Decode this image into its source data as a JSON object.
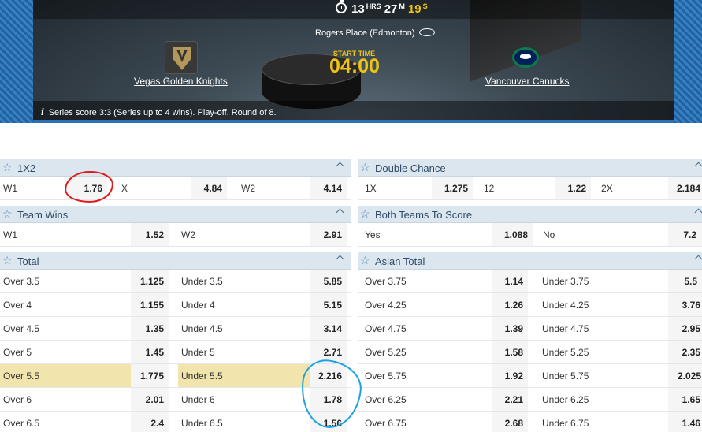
{
  "countdown": {
    "hours": "13",
    "hours_unit": "HRS",
    "minutes": "27",
    "minutes_unit": "M",
    "seconds": "19",
    "seconds_unit": "S"
  },
  "venue": "Rogers Place (Edmonton)",
  "start_time_label": "START TIME",
  "start_time": "04:00",
  "home_team": "Vegas Golden Knights",
  "away_team": "Vancouver Canucks",
  "series_info": "Series score 3:3 (Series up to 4 wins). Play-off. Round of 8.",
  "markets": {
    "m1x2": {
      "title": "1X2",
      "row": [
        {
          "label": "W1",
          "odd": "1.76"
        },
        {
          "label": "X",
          "odd": "4.84"
        },
        {
          "label": "W2",
          "odd": "4.14"
        }
      ]
    },
    "double_chance": {
      "title": "Double Chance",
      "row": [
        {
          "label": "1X",
          "odd": "1.275"
        },
        {
          "label": "12",
          "odd": "1.22"
        },
        {
          "label": "2X",
          "odd": "2.184"
        }
      ]
    },
    "team_wins": {
      "title": "Team Wins",
      "row": [
        {
          "label": "W1",
          "odd": "1.52"
        },
        {
          "label": "W2",
          "odd": "2.91"
        }
      ]
    },
    "btts": {
      "title": "Both Teams To Score",
      "row": [
        {
          "label": "Yes",
          "odd": "1.088"
        },
        {
          "label": "No",
          "odd": "7.2"
        }
      ]
    },
    "total": {
      "title": "Total",
      "rows": [
        [
          {
            "label": "Over 3.5",
            "odd": "1.125"
          },
          {
            "label": "Under 3.5",
            "odd": "5.85"
          }
        ],
        [
          {
            "label": "Over 4",
            "odd": "1.155"
          },
          {
            "label": "Under 4",
            "odd": "5.15"
          }
        ],
        [
          {
            "label": "Over 4.5",
            "odd": "1.35"
          },
          {
            "label": "Under 4.5",
            "odd": "3.14"
          }
        ],
        [
          {
            "label": "Over 5",
            "odd": "1.45"
          },
          {
            "label": "Under 5",
            "odd": "2.71"
          }
        ],
        [
          {
            "label": "Over 5.5",
            "odd": "1.775"
          },
          {
            "label": "Under 5.5",
            "odd": "2.216"
          }
        ],
        [
          {
            "label": "Over 6",
            "odd": "2.01"
          },
          {
            "label": "Under 6",
            "odd": "1.78"
          }
        ],
        [
          {
            "label": "Over 6.5",
            "odd": "2.4"
          },
          {
            "label": "Under 6.5",
            "odd": "1.56"
          }
        ]
      ]
    },
    "asian_total": {
      "title": "Asian Total",
      "rows": [
        [
          {
            "label": "Over 3.75",
            "odd": "1.14"
          },
          {
            "label": "Under 3.75",
            "odd": "5.5"
          }
        ],
        [
          {
            "label": "Over 4.25",
            "odd": "1.26"
          },
          {
            "label": "Under 4.25",
            "odd": "3.76"
          }
        ],
        [
          {
            "label": "Over 4.75",
            "odd": "1.39"
          },
          {
            "label": "Under 4.75",
            "odd": "2.95"
          }
        ],
        [
          {
            "label": "Over 5.25",
            "odd": "1.58"
          },
          {
            "label": "Under 5.25",
            "odd": "2.35"
          }
        ],
        [
          {
            "label": "Over 5.75",
            "odd": "1.92"
          },
          {
            "label": "Under 5.75",
            "odd": "2.025"
          }
        ],
        [
          {
            "label": "Over 6.25",
            "odd": "2.21"
          },
          {
            "label": "Under 6.25",
            "odd": "1.65"
          }
        ],
        [
          {
            "label": "Over 6.75",
            "odd": "2.68"
          },
          {
            "label": "Under 6.75",
            "odd": "1.46"
          }
        ]
      ]
    }
  },
  "colors": {
    "header_bg": "#dbe6ef",
    "highlight_row": "#f1e4ac",
    "start_time": "#f1c40f",
    "annotation_red": "#e01a1a",
    "annotation_blue": "#1aa3e0"
  }
}
